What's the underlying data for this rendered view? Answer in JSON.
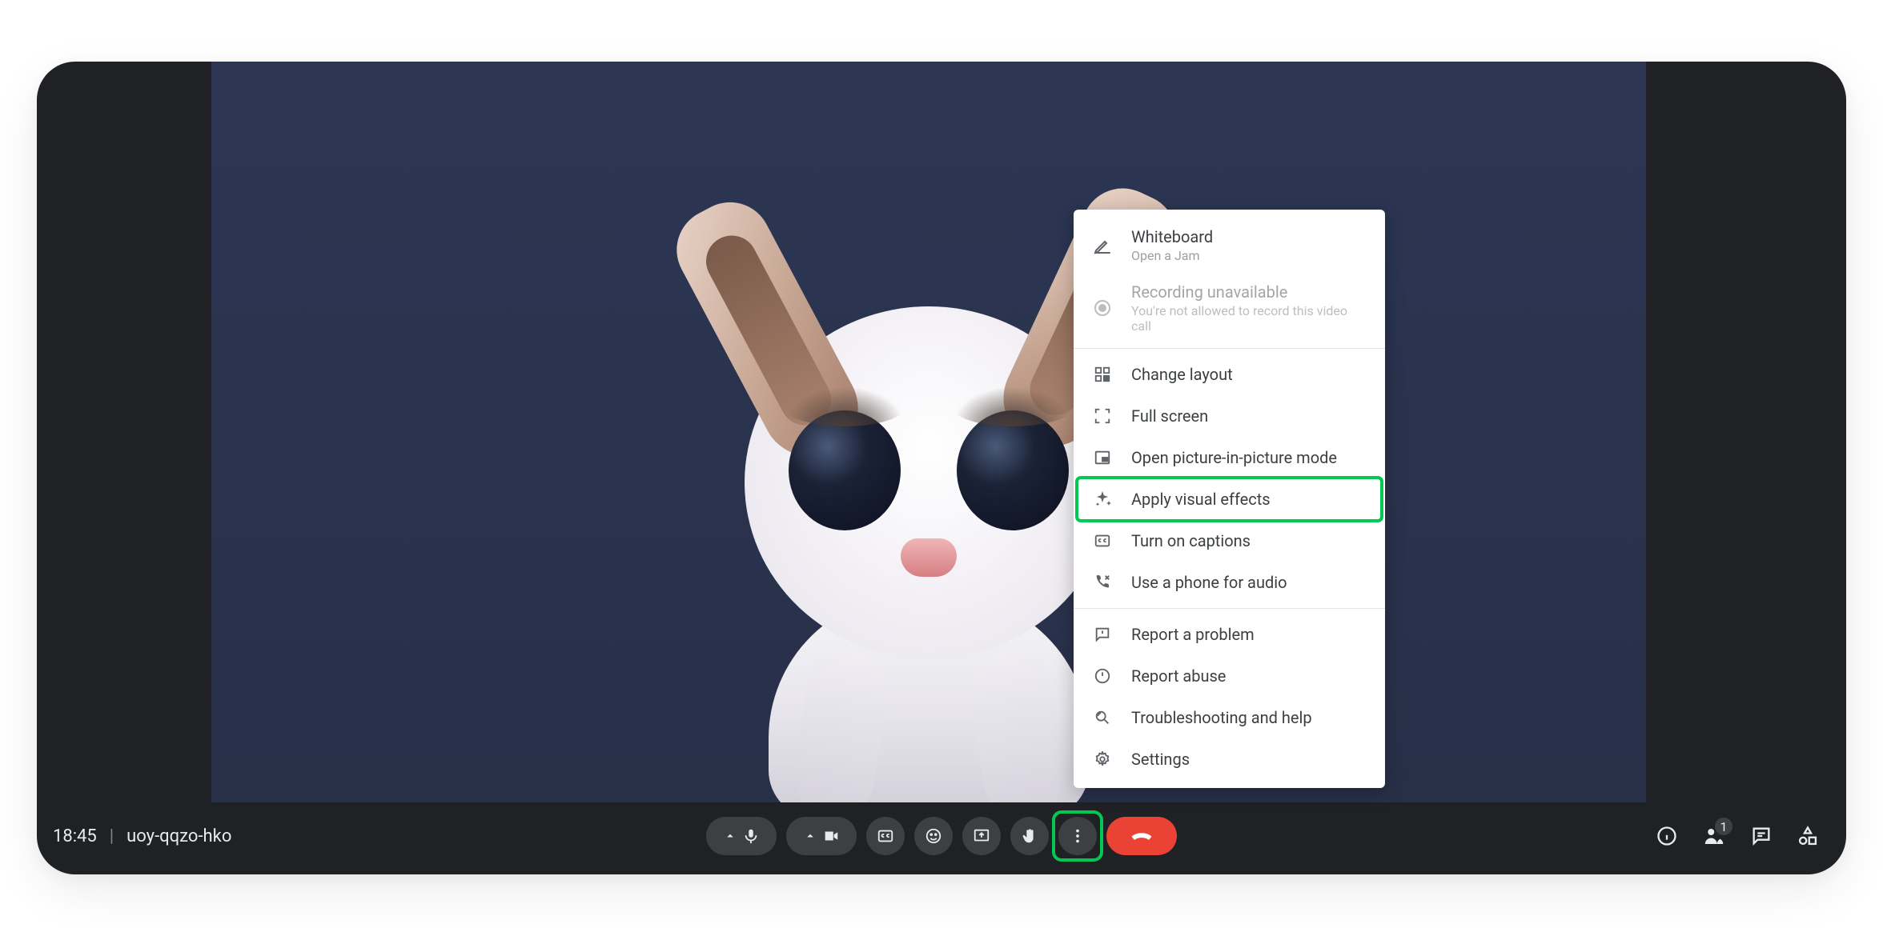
{
  "meetingTime": "18:45",
  "meetingCode": "uoy-qqzo-hko",
  "participantBadge": "1",
  "menu": {
    "whiteboard": {
      "title": "Whiteboard",
      "sub": "Open a Jam"
    },
    "recording": {
      "title": "Recording unavailable",
      "sub": "You're not allowed to record this video call"
    },
    "changeLayout": "Change layout",
    "fullScreen": "Full screen",
    "pip": "Open picture-in-picture mode",
    "visualEffects": "Apply visual effects",
    "captions": "Turn on captions",
    "phoneAudio": "Use a phone for audio",
    "reportProblem": "Report a problem",
    "reportAbuse": "Report abuse",
    "troubleshoot": "Troubleshooting and help",
    "settings": "Settings"
  }
}
